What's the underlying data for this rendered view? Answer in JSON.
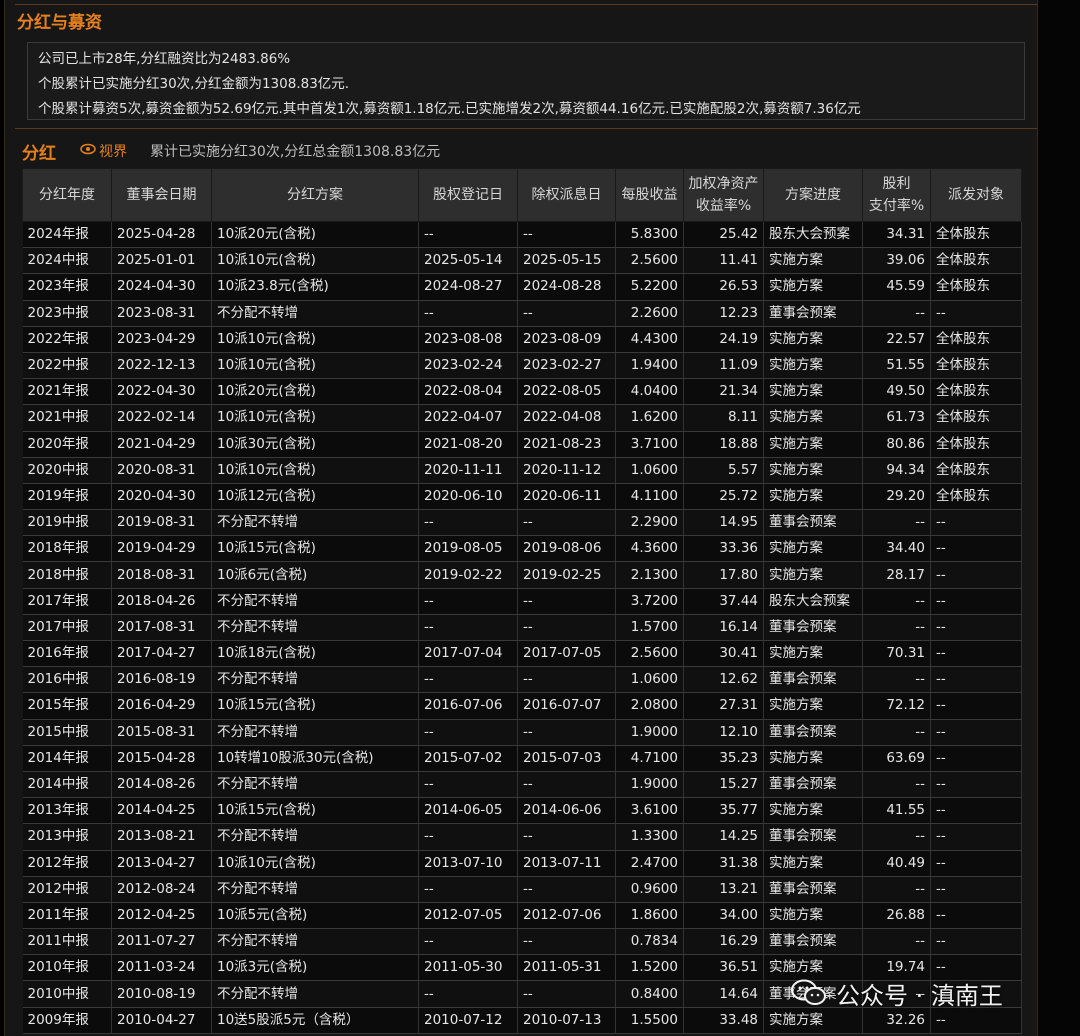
{
  "section1": {
    "title": "分红与募资",
    "lines": [
      "公司已上市28年,分红融资比为2483.86%",
      "个股累计已实施分红30次,分红金额为1308.83亿元.",
      "个股累计募资5次,募资金额为52.69亿元.其中首发1次,募资额1.18亿元.已实施增发2次,募资额44.16亿元.已实施配股2次,募资额7.36亿元"
    ]
  },
  "section2": {
    "title": "分红",
    "view_label": "视界",
    "summary": "累计已实施分红30次,分红总金额1308.83亿元"
  },
  "table": {
    "headers": [
      "分红年度",
      "董事会日期",
      "分红方案",
      "股权登记日",
      "除权派息日",
      "每股收益",
      "加权净资产收益率%",
      "方案进度",
      "股利支付率%",
      "派发对象"
    ],
    "header_lines": [
      [
        "分红年度"
      ],
      [
        "董事会日期"
      ],
      [
        "分红方案"
      ],
      [
        "股权登记日"
      ],
      [
        "除权派息日"
      ],
      [
        "每股收益"
      ],
      [
        "加权净资产",
        "收益率%"
      ],
      [
        "方案进度"
      ],
      [
        "股利",
        "支付率%"
      ],
      [
        "派发对象"
      ]
    ],
    "rows": [
      [
        "2024年报",
        "2025-04-28",
        "10派20元(含税)",
        "--",
        "--",
        "5.8300",
        "25.42",
        "股东大会预案",
        "34.31",
        "全体股东"
      ],
      [
        "2024中报",
        "2025-01-01",
        "10派10元(含税)",
        "2025-05-14",
        "2025-05-15",
        "2.5600",
        "11.41",
        "实施方案",
        "39.06",
        "全体股东"
      ],
      [
        "2023年报",
        "2024-04-30",
        "10派23.8元(含税)",
        "2024-08-27",
        "2024-08-28",
        "5.2200",
        "26.53",
        "实施方案",
        "45.59",
        "全体股东"
      ],
      [
        "2023中报",
        "2023-08-31",
        "不分配不转增",
        "--",
        "--",
        "2.2600",
        "12.23",
        "董事会预案",
        "--",
        "--"
      ],
      [
        "2022年报",
        "2023-04-29",
        "10派10元(含税)",
        "2023-08-08",
        "2023-08-09",
        "4.4300",
        "24.19",
        "实施方案",
        "22.57",
        "全体股东"
      ],
      [
        "2022中报",
        "2022-12-13",
        "10派10元(含税)",
        "2023-02-24",
        "2023-02-27",
        "1.9400",
        "11.09",
        "实施方案",
        "51.55",
        "全体股东"
      ],
      [
        "2021年报",
        "2022-04-30",
        "10派20元(含税)",
        "2022-08-04",
        "2022-08-05",
        "4.0400",
        "21.34",
        "实施方案",
        "49.50",
        "全体股东"
      ],
      [
        "2021中报",
        "2022-02-14",
        "10派10元(含税)",
        "2022-04-07",
        "2022-04-08",
        "1.6200",
        "8.11",
        "实施方案",
        "61.73",
        "全体股东"
      ],
      [
        "2020年报",
        "2021-04-29",
        "10派30元(含税)",
        "2021-08-20",
        "2021-08-23",
        "3.7100",
        "18.88",
        "实施方案",
        "80.86",
        "全体股东"
      ],
      [
        "2020中报",
        "2020-08-31",
        "10派10元(含税)",
        "2020-11-11",
        "2020-11-12",
        "1.0600",
        "5.57",
        "实施方案",
        "94.34",
        "全体股东"
      ],
      [
        "2019年报",
        "2020-04-30",
        "10派12元(含税)",
        "2020-06-10",
        "2020-06-11",
        "4.1100",
        "25.72",
        "实施方案",
        "29.20",
        "全体股东"
      ],
      [
        "2019中报",
        "2019-08-31",
        "不分配不转增",
        "--",
        "--",
        "2.2900",
        "14.95",
        "董事会预案",
        "--",
        "--"
      ],
      [
        "2018年报",
        "2019-04-29",
        "10派15元(含税)",
        "2019-08-05",
        "2019-08-06",
        "4.3600",
        "33.36",
        "实施方案",
        "34.40",
        "--"
      ],
      [
        "2018中报",
        "2018-08-31",
        "10派6元(含税)",
        "2019-02-22",
        "2019-02-25",
        "2.1300",
        "17.80",
        "实施方案",
        "28.17",
        "--"
      ],
      [
        "2017年报",
        "2018-04-26",
        "不分配不转增",
        "--",
        "--",
        "3.7200",
        "37.44",
        "股东大会预案",
        "--",
        "--"
      ],
      [
        "2017中报",
        "2017-08-31",
        "不分配不转增",
        "--",
        "--",
        "1.5700",
        "16.14",
        "董事会预案",
        "--",
        "--"
      ],
      [
        "2016年报",
        "2017-04-27",
        "10派18元(含税)",
        "2017-07-04",
        "2017-07-05",
        "2.5600",
        "30.41",
        "实施方案",
        "70.31",
        "--"
      ],
      [
        "2016中报",
        "2016-08-19",
        "不分配不转增",
        "--",
        "--",
        "1.0600",
        "12.62",
        "董事会预案",
        "--",
        "--"
      ],
      [
        "2015年报",
        "2016-04-29",
        "10派15元(含税)",
        "2016-07-06",
        "2016-07-07",
        "2.0800",
        "27.31",
        "实施方案",
        "72.12",
        "--"
      ],
      [
        "2015中报",
        "2015-08-31",
        "不分配不转增",
        "--",
        "--",
        "1.9000",
        "12.10",
        "董事会预案",
        "--",
        "--"
      ],
      [
        "2014年报",
        "2015-04-28",
        "10转增10股派30元(含税)",
        "2015-07-02",
        "2015-07-03",
        "4.7100",
        "35.23",
        "实施方案",
        "63.69",
        "--"
      ],
      [
        "2014中报",
        "2014-08-26",
        "不分配不转增",
        "--",
        "--",
        "1.9000",
        "15.27",
        "董事会预案",
        "--",
        "--"
      ],
      [
        "2013年报",
        "2014-04-25",
        "10派15元(含税)",
        "2014-06-05",
        "2014-06-06",
        "3.6100",
        "35.77",
        "实施方案",
        "41.55",
        "--"
      ],
      [
        "2013中报",
        "2013-08-21",
        "不分配不转增",
        "--",
        "--",
        "1.3300",
        "14.25",
        "董事会预案",
        "--",
        "--"
      ],
      [
        "2012年报",
        "2013-04-27",
        "10派10元(含税)",
        "2013-07-10",
        "2013-07-11",
        "2.4700",
        "31.38",
        "实施方案",
        "40.49",
        "--"
      ],
      [
        "2012中报",
        "2012-08-24",
        "不分配不转增",
        "--",
        "--",
        "0.9600",
        "13.21",
        "董事会预案",
        "--",
        "--"
      ],
      [
        "2011年报",
        "2012-04-25",
        "10派5元(含税)",
        "2012-07-05",
        "2012-07-06",
        "1.8600",
        "34.00",
        "实施方案",
        "26.88",
        "--"
      ],
      [
        "2011中报",
        "2011-07-27",
        "不分配不转增",
        "--",
        "--",
        "0.7834",
        "16.29",
        "董事会预案",
        "--",
        "--"
      ],
      [
        "2010年报",
        "2011-03-24",
        "10派3元(含税)",
        "2011-05-30",
        "2011-05-31",
        "1.5200",
        "36.51",
        "实施方案",
        "19.74",
        "--"
      ],
      [
        "2010中报",
        "2010-08-19",
        "不分配不转增",
        "--",
        "--",
        "0.8400",
        "14.64",
        "董事会预案",
        "--",
        "--"
      ],
      [
        "2009年报",
        "2010-04-27",
        "10送5股派5元（含税）",
        "2010-07-12",
        "2010-07-13",
        "1.5500",
        "33.48",
        "实施方案",
        "32.26",
        "--"
      ]
    ]
  },
  "watermark": {
    "text": "公众号 · 滇南王",
    "icon": "wechat-icon"
  },
  "colors": {
    "accent": "#e5801e",
    "header_bg": "#2e2e2e",
    "row_bg": "#0b0b0b"
  }
}
